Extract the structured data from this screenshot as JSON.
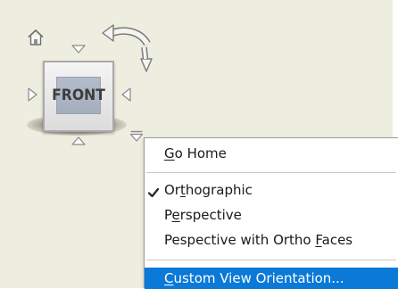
{
  "viewcube": {
    "face_label": "FRONT"
  },
  "icons": {
    "home": "home-icon",
    "rotate": "rotate-arrow-icon",
    "arrow_up": "triangle-up-icon",
    "arrow_down": "triangle-down-icon",
    "arrow_left": "triangle-left-icon",
    "arrow_right": "triangle-right-icon",
    "menu": "menu-dropdown-icon",
    "check": "checkmark-icon"
  },
  "context_menu": {
    "items": [
      {
        "pre": "",
        "key": "G",
        "post": "o Home",
        "checked": false,
        "selected": false
      },
      {
        "pre": "Or",
        "key": "t",
        "post": "hographic",
        "checked": true,
        "selected": false
      },
      {
        "pre": "P",
        "key": "e",
        "post": "rspective",
        "checked": false,
        "selected": false
      },
      {
        "pre": "Pespective with Ortho ",
        "key": "F",
        "post": "aces",
        "checked": false,
        "selected": false
      },
      {
        "pre": "",
        "key": "C",
        "post": "ustom View Orientation...",
        "checked": false,
        "selected": true
      }
    ]
  },
  "colors": {
    "viewport_bg": "#eeeee0",
    "menu_highlight": "#0a79d8",
    "cube_face": "#aab2c1"
  }
}
